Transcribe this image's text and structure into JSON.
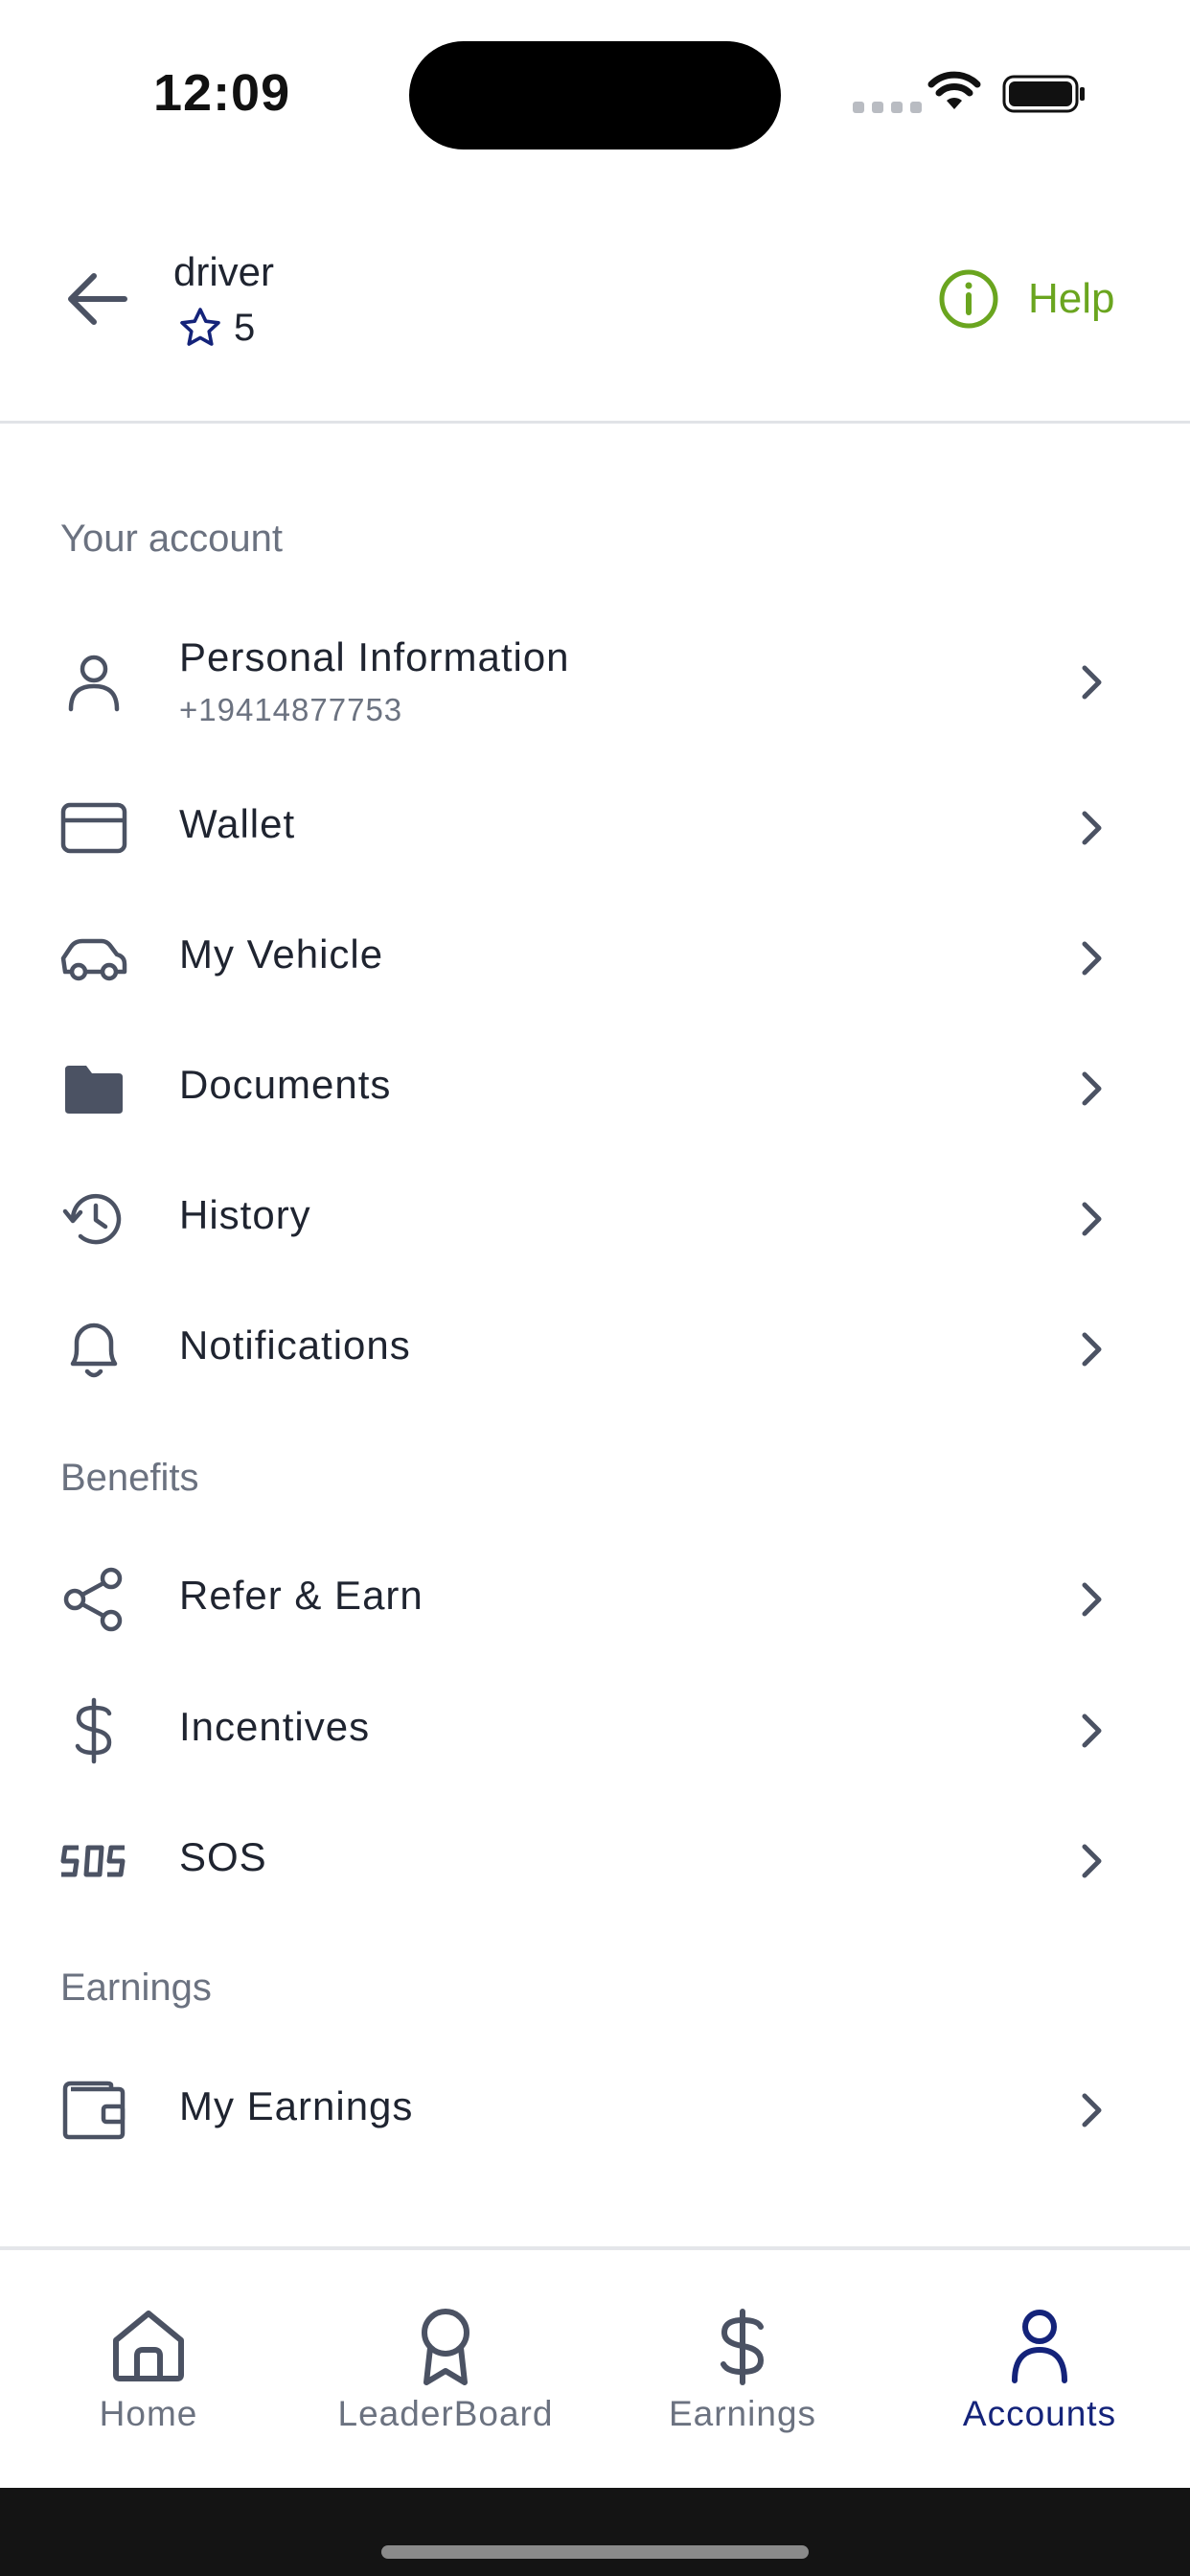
{
  "status_bar": {
    "time": "12:09"
  },
  "header": {
    "driver_name": "driver",
    "rating": "5",
    "help_label": "Help"
  },
  "sections": {
    "account": {
      "title": "Your account",
      "items": [
        {
          "label": "Personal Information",
          "subtitle": "+19414877753",
          "icon": "user-icon"
        },
        {
          "label": "Wallet",
          "icon": "credit-card-icon"
        },
        {
          "label": "My Vehicle",
          "icon": "car-icon"
        },
        {
          "label": "Documents",
          "icon": "folder-icon"
        },
        {
          "label": "History",
          "icon": "history-icon"
        },
        {
          "label": "Notifications",
          "icon": "bell-icon"
        }
      ]
    },
    "benefits": {
      "title": "Benefits",
      "items": [
        {
          "label": "Refer & Earn",
          "icon": "share-icon"
        },
        {
          "label": "Incentives",
          "icon": "dollar-icon"
        },
        {
          "label": "SOS",
          "icon": "sos-icon"
        }
      ]
    },
    "earnings": {
      "title": "Earnings",
      "items": [
        {
          "label": "My Earnings",
          "icon": "wallet-icon"
        }
      ]
    }
  },
  "bottom_nav": {
    "tabs": [
      {
        "label": "Home",
        "icon": "home-icon",
        "active": false
      },
      {
        "label": "LeaderBoard",
        "icon": "award-icon",
        "active": false
      },
      {
        "label": "Earnings",
        "icon": "dollar-icon",
        "active": false
      },
      {
        "label": "Accounts",
        "icon": "user-icon",
        "active": true
      }
    ]
  },
  "colors": {
    "accent": "#14237a",
    "help": "#6aa51f",
    "icon": "#4b5263",
    "muted": "#6b7280"
  }
}
